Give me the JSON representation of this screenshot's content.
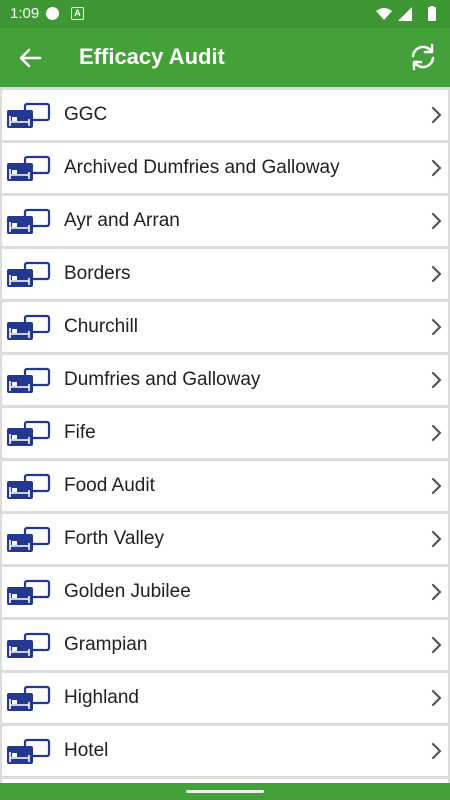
{
  "status": {
    "time": "1:09",
    "a_badge": "A"
  },
  "appbar": {
    "title": "Efficacy Audit",
    "back_icon": "arrow-back-icon",
    "refresh_icon": "refresh-icon"
  },
  "items": [
    {
      "label": "GGC"
    },
    {
      "label": "Archived Dumfries and Galloway"
    },
    {
      "label": "Ayr and Arran"
    },
    {
      "label": "Borders"
    },
    {
      "label": "Churchill"
    },
    {
      "label": "Dumfries and Galloway"
    },
    {
      "label": "Fife"
    },
    {
      "label": "Food Audit"
    },
    {
      "label": "Forth Valley"
    },
    {
      "label": "Golden Jubilee"
    },
    {
      "label": "Grampian"
    },
    {
      "label": "Highland"
    },
    {
      "label": "Hotel"
    }
  ],
  "colors": {
    "primary": "#44a13a",
    "status": "#3f9635",
    "icon": "#24388f"
  }
}
